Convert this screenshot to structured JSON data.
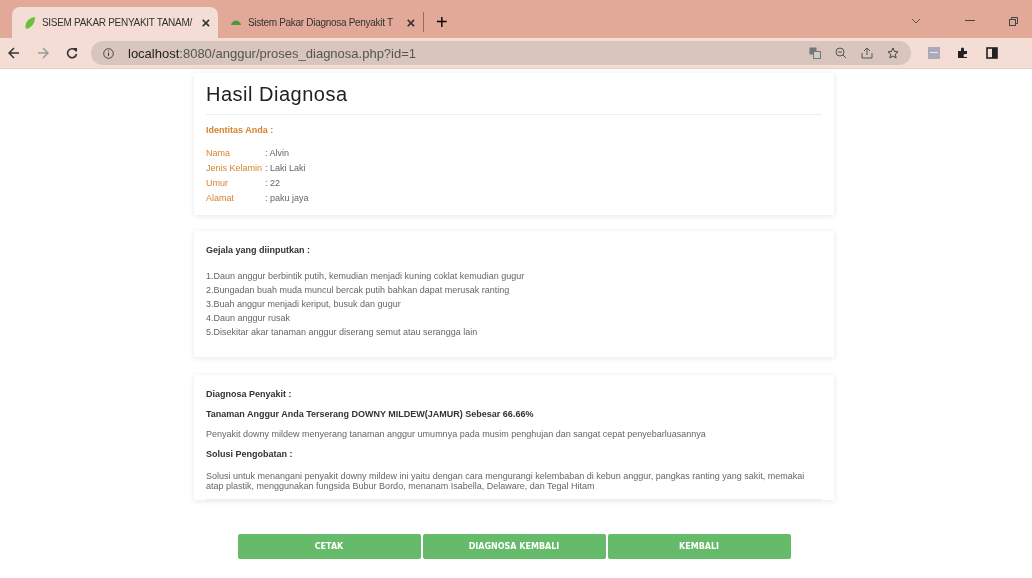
{
  "browser": {
    "tabs": [
      {
        "title": "SISEM PAKAR PENYAKIT TANAM/",
        "close": "×",
        "selected": true
      },
      {
        "title": "Sistem Pakar Diagnosa Penyakit T",
        "close": "×",
        "selected": false
      }
    ],
    "new_tab": "+",
    "url_host": "localhost",
    "url_rest": ":8080/anggur/proses_diagnosa.php?id=1"
  },
  "identity": {
    "title": "Hasil Diagnosa",
    "heading": "Identitas Anda :",
    "fields": [
      {
        "label": "Nama",
        "value": ": Alvin"
      },
      {
        "label": "Jenis Kelamin",
        "value": ": Laki Laki"
      },
      {
        "label": "Umur",
        "value": ": 22"
      },
      {
        "label": "Alamat",
        "value": ": paku jaya"
      }
    ]
  },
  "symptoms": {
    "heading": "Gejala yang diinputkan :",
    "items": [
      "1.Daun anggur berbintik putih, kemudian menjadi kuning coklat kemudian gugur",
      "2.Bungadan buah muda muncul bercak putih bahkan dapat merusak ranting",
      "3.Buah anggur menjadi keriput, busuk dan gugur",
      "4.Daun anggur rusak",
      "5.Disekitar akar tanaman anggur diserang semut atau serangga lain"
    ]
  },
  "diagnosis": {
    "heading": "Diagnosa Penyakit :",
    "result": "Tanaman Anggur Anda Terserang DOWNY MILDEW(JAMUR) Sebesar 66.66%",
    "description": "Penyakit downy mildew menyerang tanaman anggur umumnya pada musim penghujan dan sangat cepat penyebarluasannya",
    "solution_heading": "Solusi Pengobatan :",
    "solution": "Solusi untuk menangani penyakit downy mildew ini yaitu dengan cara mengurangi kelembaban di kebun anggur, pangkas ranting yang sakit, memakai atap plastik, menggunakan fungsida Bubur Bordo, menanam Isabella, Delaware, dan Tegal Hitam"
  },
  "buttons": [
    "CETAK",
    "DIAGNOSA KEMBALI",
    "KEMBALI"
  ]
}
